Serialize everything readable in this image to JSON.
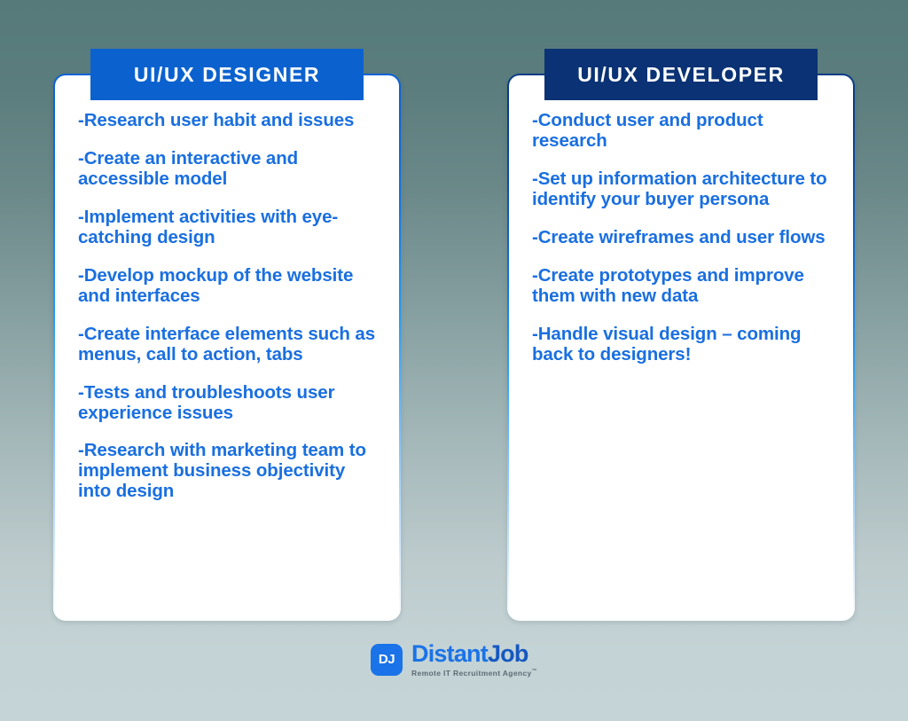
{
  "background": {
    "gradient_top": "#56797a",
    "gradient_bottom": "#c5d4d6"
  },
  "accent_colors": {
    "designer_header": "#0b62cf",
    "developer_header": "#0a3274",
    "bullet_text": "#1a6fe0",
    "logo_blue": "#1a73e8"
  },
  "cards": [
    {
      "id": "designer",
      "title": "UI/UX DESIGNER",
      "bullets": [
        "-Research user habit and issues",
        "-Create an interactive and accessible model",
        "-Implement activities with eye-catching design",
        "-Develop mockup of the website and interfaces",
        "-Create interface elements such as menus, call to action, tabs",
        "-Tests and troubleshoots user experience issues",
        "-Research with marketing team to implement business objectivity into design"
      ]
    },
    {
      "id": "developer",
      "title": "UI/UX DEVELOPER",
      "bullets": [
        "-Conduct user and product research",
        "-Set up information architecture to identify your buyer persona",
        "-Create wireframes and user flows",
        "-Create prototypes and improve them with new data",
        "-Handle visual design – coming back to designers!"
      ]
    }
  ],
  "logo": {
    "mark_text": "DJ",
    "word_part1": "Distant",
    "word_part2": "Job",
    "tagline": "Remote IT Recruitment Agency",
    "trademark": "™"
  }
}
